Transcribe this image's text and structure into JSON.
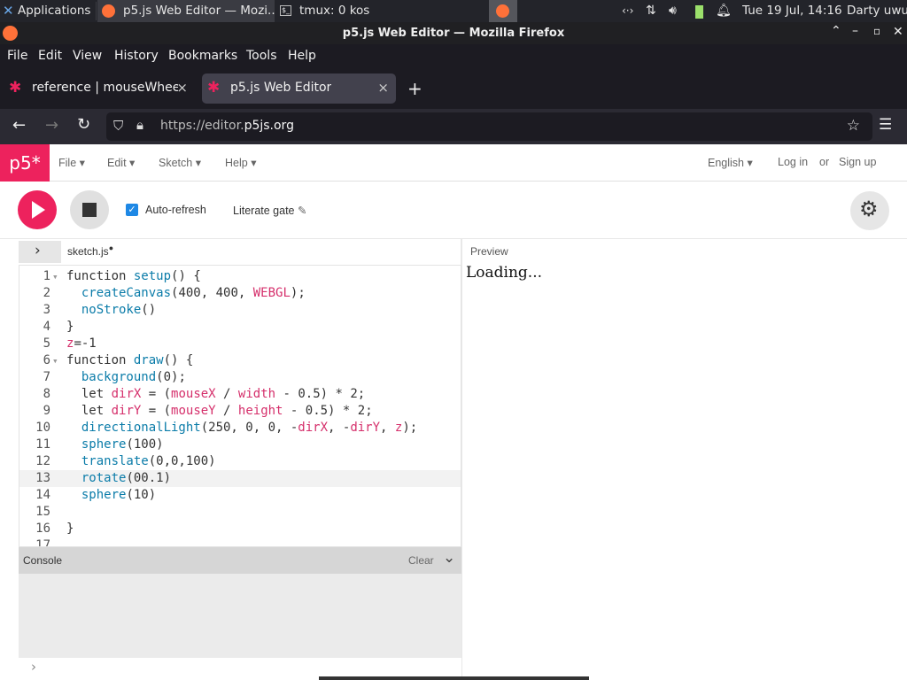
{
  "taskbar": {
    "applications": "Applications",
    "window1": "p5.js Web Editor — Mozi...",
    "window2": "tmux: 0 kos",
    "datetime": "Tue 19 Jul, 14:16",
    "user": "Darty uwu"
  },
  "firefox": {
    "window_title": "p5.js Web Editor — Mozilla Firefox",
    "menu": [
      "File",
      "Edit",
      "View",
      "History",
      "Bookmarks",
      "Tools",
      "Help"
    ],
    "tabs": [
      {
        "label": "reference | mouseWheel()",
        "close": "×"
      },
      {
        "label": "p5.js Web Editor",
        "close": "×"
      }
    ],
    "new_tab": "+",
    "url_prefix": "https://editor.",
    "url_domain": "p5js.org"
  },
  "p5": {
    "logo": "p5*",
    "menus": [
      "File",
      "Edit",
      "Sketch",
      "Help"
    ],
    "language": "English",
    "login": "Log in",
    "or": "or",
    "signup": "Sign up",
    "autorefresh_label": "Auto-refresh",
    "sketch_name": "Literate gate",
    "file_name": "sketch.js",
    "preview_label": "Preview",
    "preview_loading": "Loading...",
    "console_label": "Console",
    "console_clear": "Clear",
    "console_prompt": "›"
  },
  "code": {
    "active_line": 13,
    "lines": [
      {
        "n": "1",
        "text": "function setup() {"
      },
      {
        "n": "2",
        "text": "  createCanvas(400, 400, WEBGL);"
      },
      {
        "n": "3",
        "text": "  noStroke()"
      },
      {
        "n": "4",
        "text": "}"
      },
      {
        "n": "5",
        "text": "z=-1"
      },
      {
        "n": "6",
        "text": "function draw() {"
      },
      {
        "n": "7",
        "text": "  background(0);"
      },
      {
        "n": "8",
        "text": "  let dirX = (mouseX / width - 0.5) * 2;"
      },
      {
        "n": "9",
        "text": "  let dirY = (mouseY / height - 0.5) * 2;"
      },
      {
        "n": "10",
        "text": "  directionalLight(250, 0, 0, -dirX, -dirY, z);"
      },
      {
        "n": "11",
        "text": "  sphere(100)"
      },
      {
        "n": "12",
        "text": "  translate(0,0,100)"
      },
      {
        "n": "13",
        "text": "  rotate(00.1)"
      },
      {
        "n": "14",
        "text": "  sphere(10)"
      },
      {
        "n": "15",
        "text": ""
      },
      {
        "n": "16",
        "text": "}"
      },
      {
        "n": "17",
        "text": ""
      }
    ]
  },
  "colors": {
    "p5_pink": "#ed225d",
    "checkbox": "#1e88e5"
  }
}
